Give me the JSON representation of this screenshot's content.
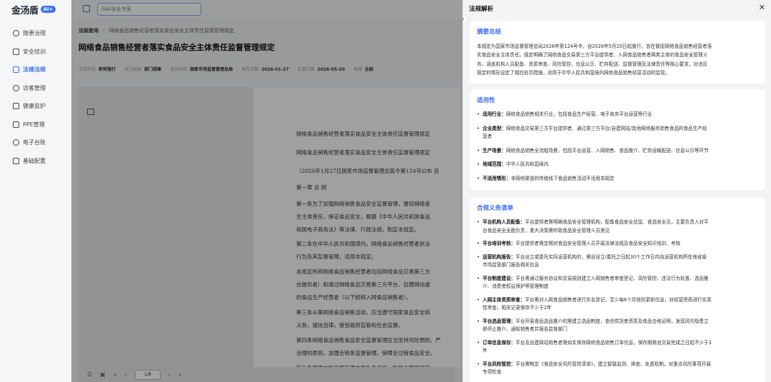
{
  "app": {
    "logo_text": "金汤盾",
    "logo_badge": "AI+"
  },
  "search": {
    "placeholder": "问AI安全专家"
  },
  "sidebar": {
    "items": [
      {
        "label": "隐患治理",
        "icon": "target-icon",
        "active": false
      },
      {
        "label": "安全培训",
        "icon": "screen-icon",
        "active": false
      },
      {
        "label": "法律法规",
        "icon": "book-icon",
        "active": true
      },
      {
        "label": "访客管理",
        "icon": "visitor-icon",
        "active": false
      },
      {
        "label": "健康监护",
        "icon": "shield-icon",
        "active": false
      },
      {
        "label": "PPE管理",
        "icon": "ppe-icon",
        "active": false
      },
      {
        "label": "电子台账",
        "icon": "ledger-icon",
        "active": false
      },
      {
        "label": "基础配置",
        "icon": "gear-icon",
        "active": false
      }
    ]
  },
  "breadcrumb": {
    "root": "法规查询",
    "separator": "/",
    "current": "网络食品销售经营者落实食品安全主体责任监督管理规定"
  },
  "page_title": "网络食品销售经营者落实食品安全主体责任监督管理规定",
  "meta": [
    {
      "label": "法规状态",
      "value": "即将施行"
    },
    {
      "label": "效力层级",
      "value": "部门规章"
    },
    {
      "label": "发布机构",
      "value": "国家市场监督管理总局"
    },
    {
      "label": "发布日期",
      "value": "2026-01-27"
    },
    {
      "label": "实施日期",
      "value": "2026-05-20"
    },
    {
      "label": "地域",
      "value": "全国"
    }
  ],
  "document": {
    "lines": [
      "网络食品销售经营者落实食品安全主体责任监督管理规定",
      "网络食品销售经营者落实食品安全主体责任监督管理规定",
      "（2026年1月27日国家市场监督管理总局令第124号公布  自",
      "第一章  总  则",
      "第一条为了加强网络销售食品安全监督管理，督促网络食",
      "全主体责任，保证食品安全，根据《中华人民共和国食品",
      "和国电子商务法》等法律、行政法规，制定本规定。",
      "第二条在中华人民共和国境内，网络食品销售经营者依法",
      "行为及其监督管理，适用本规定。",
      "本规定所称网络食品销售经营者包括网络食品交易第三方",
      "台提供者）和通过网络食品交易第三方平台、自建网站或",
      "的食品生产经营者（以下统称入网食品销售者）。",
      "第三条从事网络食品销售活动，应当遵守国家食品安全和",
      "义务，诚信自律，接受政府监管和社会监督。",
      "第四条网络食品销售食品安全监督管理应当坚持风险预防、严",
      "治理的原则，加强全链条监督管理，保障全过程食品安全。",
      "第五条国家市场监督管理总局负责组织、指导全国网络销"
    ]
  },
  "pager": {
    "value": "1/8"
  },
  "drawer": {
    "title": "法规解析",
    "summary": {
      "title": "摘要总结",
      "lines": [
        "本规定为国家市场监督管理总局2026年第124号令，自2026年5月20日起施行，旨在督促网络食品销售经营者落",
        "实食品安全主体责任。规定明确了网络食品交易第三方平台提供者、入网食品销售者两类主体的食品安全管理义",
        "务，涵盖机构人员配备、资质审查、风险管控、信息公示、贮存配送、监督管理及法律责任等核心要求，对违反",
        "规定的情形设定了相应处罚措施，适用于中华人民共和国境内网络食品销售经营活动的监管。"
      ]
    },
    "applicability": {
      "title": "适用性",
      "items": [
        {
          "key": "适用行业：",
          "lines": [
            "网络食品销售相关行业，包括食品生产经营、电子商务平台运营等行业"
          ]
        },
        {
          "key": "企业类型：",
          "lines": [
            "网络食品交易第三方平台提供者、通过第三方平台/自建网站/其他网络服务销售食品的食品生产经",
            "营者"
          ]
        },
        {
          "key": "生产场景：",
          "lines": [
            "网络食品销售全流程场景，包括平台运营、入网销售、食品推介、贮存运输配送、信息公示等环节"
          ]
        },
        {
          "key": "地域范围：",
          "lines": [
            "中华人民共和国境内"
          ]
        },
        {
          "key": "不适用情形：",
          "lines": [
            "非网络渠道的传统线下食品销售活动不适用本规定"
          ]
        }
      ]
    },
    "obligations": {
      "title": "合规义务清单",
      "items": [
        {
          "key": "平台机构人员配备：",
          "lines": [
            "平台提供者需明确食品安全管理机构，配备食品安全总监、食品安全员，主要负责人对平",
            "台食品安全全面负责，重大决策需听取食品安全管理人员意见"
          ]
        },
        {
          "key": "平台培训考核：",
          "lines": [
            "平台提供者需定期对食品安全管理人员开展法律法规及食品安全知识培训、考核"
          ]
        },
        {
          "key": "运营机构报告：",
          "lines": [
            "平台设立或委托实际运营机构的，需自设立/委托之日起30个工作日内向运营机构所在地省级",
            "市场监管部门报告相关信息"
          ]
        },
        {
          "key": "平台制度建设：",
          "lines": [
            "平台需通过服务协议和交易规则建立入网销售者审查登记、风险管控、违法行为处置、选品推",
            "介、消费者权益保护等管理制度"
          ]
        },
        {
          "key": "入网主体资质审查：",
          "lines": [
            "平台需对入网食品销售者进行实名登记，至少每6个月核验更新信息，对经营资质进行实质",
            "性审查，相关记录保存不少于2年"
          ]
        },
        {
          "key": "平台选品管理：",
          "lines": [
            "平台开展食品选品推介的需建立选品制度，查验供货者资质及食品合格证明，发现风险隐患立",
            "即停止推介、通知销售者并报告监督部门"
          ]
        },
        {
          "key": "订单信息保存：",
          "lines": [
            "平台及自建网站销售者需如实保存网络食品销售订单信息，保存期限自交易完成之日起不少于3",
            "年"
          ]
        },
        {
          "key": "平台风险管控：",
          "lines": [
            "平台需制定《食品安全风险管控清单》，建立智能监测、排查、处置机制，对重点风险事项开展",
            "专项检查"
          ]
        }
      ]
    }
  }
}
